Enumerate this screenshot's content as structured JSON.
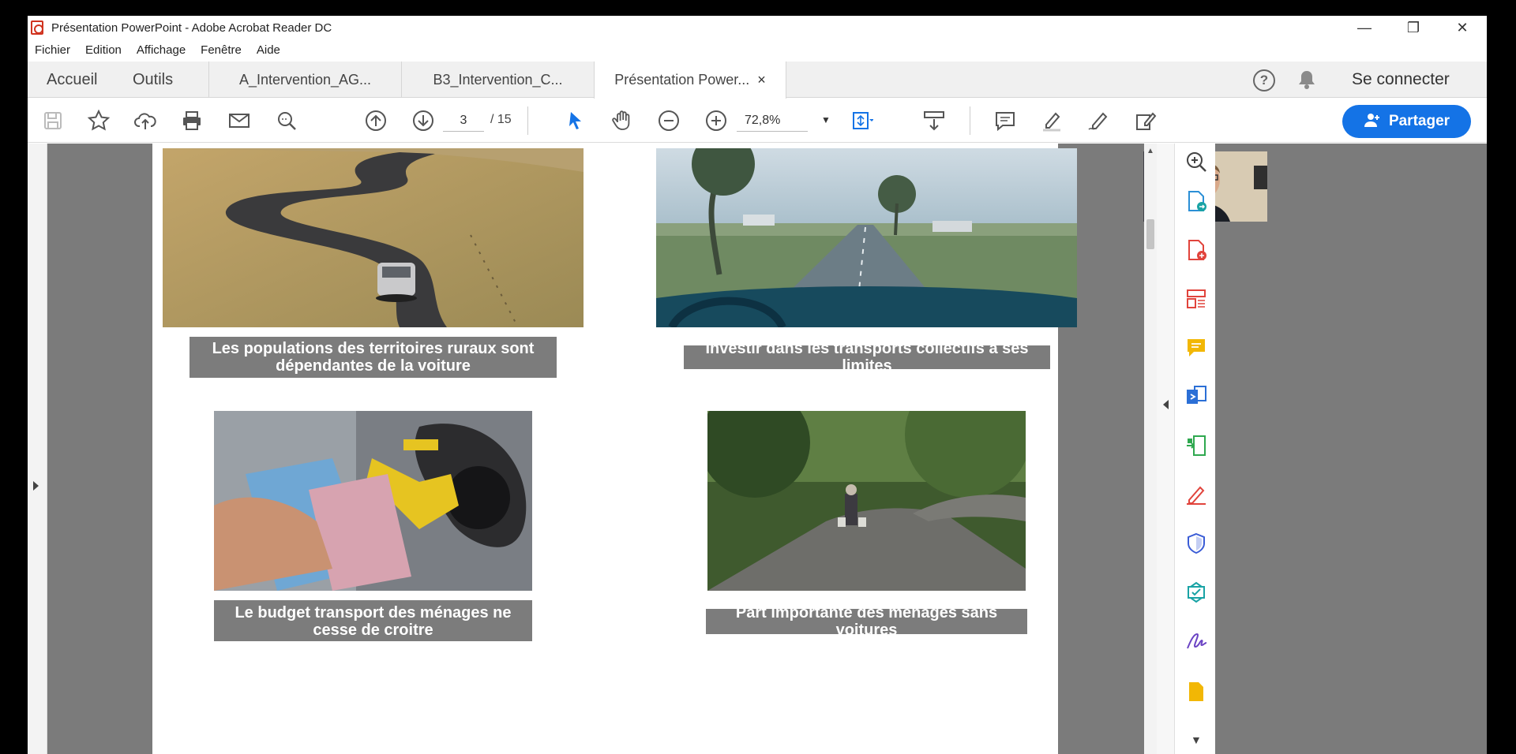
{
  "window": {
    "title": "Présentation PowerPoint - Adobe Acrobat Reader DC",
    "controls": {
      "minimize": "—",
      "restore": "❐",
      "close": "✕"
    }
  },
  "menu": [
    "Fichier",
    "Edition",
    "Affichage",
    "Fenêtre",
    "Aide"
  ],
  "nav": {
    "home": "Accueil",
    "tools": "Outils"
  },
  "tabs": [
    {
      "label": "A_Intervention_AG..."
    },
    {
      "label": "B3_Intervention_C..."
    },
    {
      "label": "Présentation Power...",
      "close": "×"
    }
  ],
  "header_right": {
    "help": "?",
    "sign_in": "Se connecter"
  },
  "toolbar": {
    "page_current": "3",
    "page_total": "/ 15",
    "zoom": "72,8%",
    "share_label": "Partager"
  },
  "slide": {
    "captions": {
      "rural_dependence": "Les populations des territoires ruraux sont dépendantes de la voiture",
      "collective_transport": "Investir dans les transports collectifs a ses limites",
      "budget": "Le budget transport des ménages ne cesse de croitre",
      "no_car_households": "Part importante des ménages sans voitures"
    }
  },
  "colors": {
    "accent": "#1473e6",
    "caption_bg": "#7c7c7c",
    "workspace_bg": "#7b7b7b"
  }
}
